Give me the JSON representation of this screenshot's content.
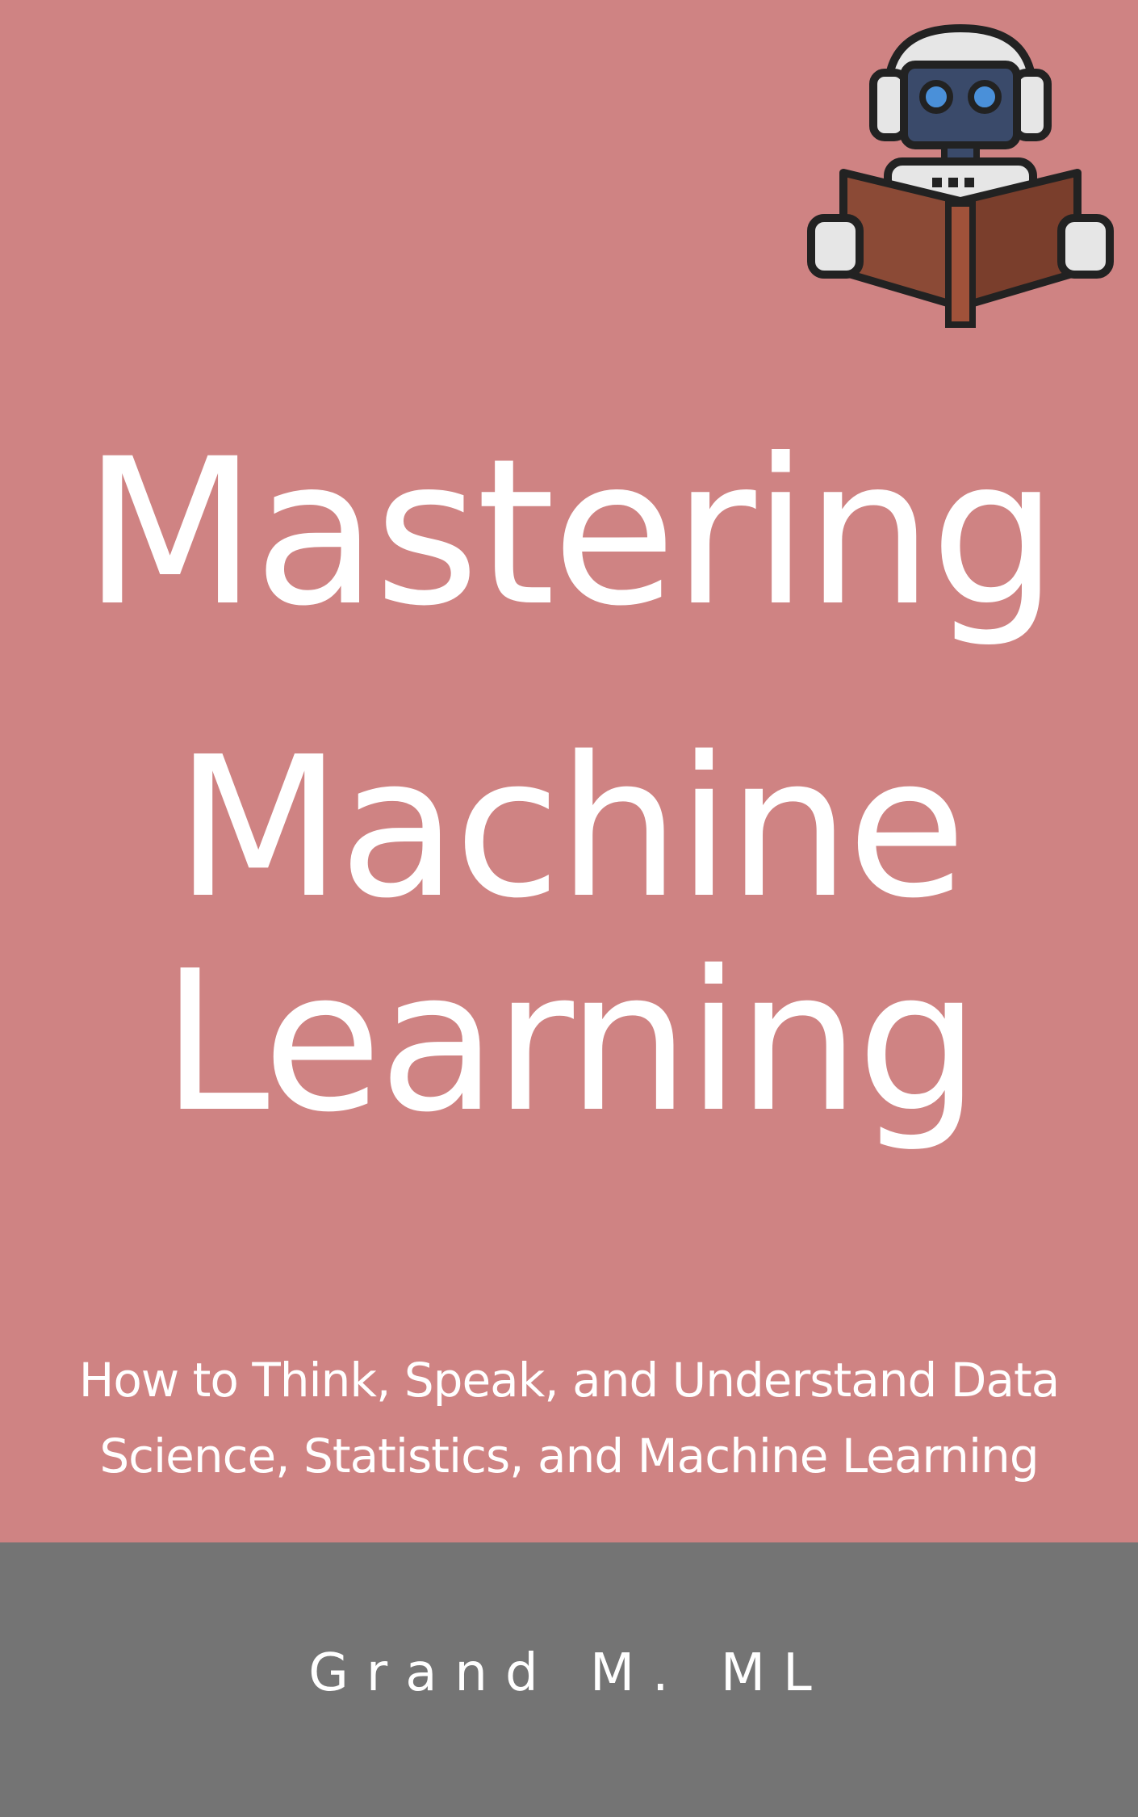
{
  "cover": {
    "background_color": "#cf8383",
    "illustration_icon": "robot-reading-book-icon",
    "title_lines": [
      "Mastering",
      "Machine",
      "Learning"
    ],
    "subtitle_lines": [
      "How to Think, Speak, and Understand Data",
      "Science, Statistics, and Machine Learning"
    ]
  },
  "footer": {
    "background_color": "#747474",
    "author": "Grand M. ML"
  }
}
